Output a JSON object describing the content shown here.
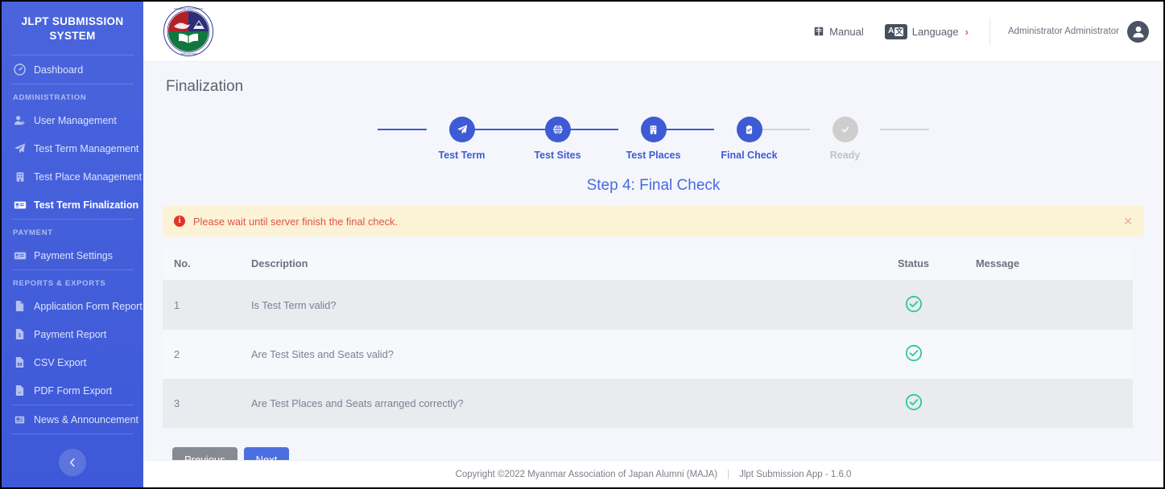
{
  "sidebar": {
    "brand": "JLPT SUBMISSION SYSTEM",
    "items": [
      {
        "label": "Dashboard",
        "icon": "dashboard-icon",
        "active": false
      },
      {
        "label": "User Management",
        "icon": "user-add-icon",
        "active": false
      },
      {
        "label": "Test Term Management",
        "icon": "paper-plane-icon",
        "active": false
      },
      {
        "label": "Test Place Management",
        "icon": "building-icon",
        "active": false
      },
      {
        "label": "Test Term Finalization",
        "icon": "id-card-icon",
        "active": true
      },
      {
        "label": "Payment Settings",
        "icon": "payment-card-icon",
        "active": false
      },
      {
        "label": "Application Form Report",
        "icon": "file-icon",
        "active": false
      },
      {
        "label": "Payment Report",
        "icon": "file-dollar-icon",
        "active": false
      },
      {
        "label": "CSV Export",
        "icon": "file-csv-icon",
        "active": false
      },
      {
        "label": "PDF Form Export",
        "icon": "file-pdf-icon",
        "active": false
      },
      {
        "label": "News & Announcement",
        "icon": "news-icon",
        "active": false
      }
    ],
    "sections": {
      "administration": "ADMINISTRATION",
      "payment": "PAYMENT",
      "reports": "REPORTS & EXPORTS"
    },
    "collapse_icon": "chevron-left-icon",
    "accent_color": "#4460DC"
  },
  "topbar": {
    "logo_alt": "maja-seal-logo",
    "manual_label": "Manual",
    "manual_icon": "book-icon",
    "language_label": "Language",
    "language_icon": "translate-icon",
    "language_chevron": "›",
    "user_name": "Administrator Administrator",
    "avatar_icon": "user-avatar-icon"
  },
  "page": {
    "title": "Finalization",
    "step_heading": "Step 4: Final Check"
  },
  "stepper": {
    "steps": [
      {
        "label": "Test Term",
        "icon": "paper-plane-icon",
        "state": "active"
      },
      {
        "label": "Test Sites",
        "icon": "globe-icon",
        "state": "active"
      },
      {
        "label": "Test Places",
        "icon": "building-icon",
        "state": "active"
      },
      {
        "label": "Final Check",
        "icon": "clipboard-icon",
        "state": "active"
      },
      {
        "label": "Ready",
        "icon": "check-icon",
        "state": "pending"
      }
    ],
    "active_color": "#3E5BD6",
    "pending_color": "#CECECE"
  },
  "alert": {
    "icon": "info-icon",
    "icon_glyph": "i",
    "message": "Please wait until server finish the final check.",
    "close_glyph": "✕",
    "background": "#FCF3D7",
    "text_color": "#E0514A"
  },
  "table": {
    "columns": [
      "No.",
      "Description",
      "Status",
      "Message"
    ],
    "rows": [
      {
        "no": "1",
        "description": "Is Test Term valid?",
        "status": "check-circle-icon",
        "message": ""
      },
      {
        "no": "2",
        "description": "Are Test Sites and Seats valid?",
        "status": "check-circle-icon",
        "message": ""
      },
      {
        "no": "3",
        "description": "Are Test Places and Seats arranged correctly?",
        "status": "check-circle-icon",
        "message": ""
      }
    ],
    "status_color": "#2ECC8F"
  },
  "buttons": {
    "previous": "Previous",
    "next": "Next"
  },
  "footer": {
    "copyright": "Copyright ©2022 Myanmar Association of Japan Alumni (MAJA)",
    "separator": "|",
    "version": "Jlpt Submission App - 1.6.0"
  }
}
